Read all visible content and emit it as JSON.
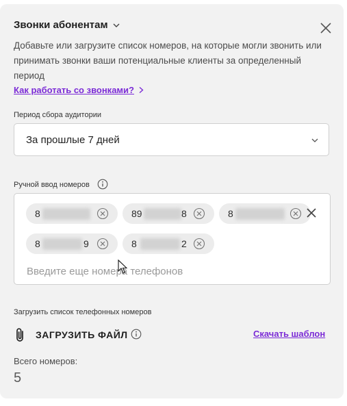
{
  "header": {
    "title": "Звонки абонентам",
    "description": "Добавьте или загрузите список номеров, на которые могли звонить или принимать звонки ваши потенциальные клиенты за определенный период"
  },
  "help_link": "Как работать со звонками?",
  "period": {
    "label": "Период сбора аудитории",
    "selected": "За прошлые 7 дней"
  },
  "manual": {
    "label": "Ручной ввод номеров",
    "numbers": [
      "8",
      "89",
      "8",
      "8",
      "8"
    ],
    "number_suffixes": [
      "",
      "8",
      "",
      "9",
      "2"
    ],
    "placeholder": "Введите еще номера телефонов"
  },
  "upload": {
    "label": "Загрузить список телефонных номеров",
    "button": "ЗАГРУЗИТЬ ФАЙЛ",
    "template_link": "Скачать шаблон"
  },
  "totals": {
    "label": "Всего номеров:",
    "value": "5"
  },
  "colors": {
    "accent": "#7b2bd6",
    "panel_bg": "#f2f2f2",
    "chip_bg": "#ececec"
  }
}
